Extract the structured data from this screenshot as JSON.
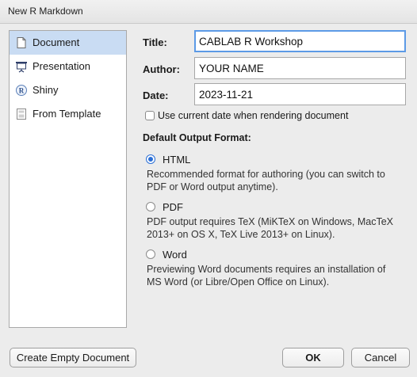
{
  "window": {
    "title": "New R Markdown"
  },
  "sidebar": {
    "items": [
      {
        "label": "Document",
        "icon": "document-icon",
        "selected": true
      },
      {
        "label": "Presentation",
        "icon": "presentation-icon",
        "selected": false
      },
      {
        "label": "Shiny",
        "icon": "shiny-icon",
        "selected": false
      },
      {
        "label": "From Template",
        "icon": "template-icon",
        "selected": false
      }
    ]
  },
  "form": {
    "title_label": "Title:",
    "title_value": "CABLAB R Workshop",
    "author_label": "Author:",
    "author_value": "YOUR NAME",
    "date_label": "Date:",
    "date_value": "2023-11-21",
    "use_current_date_label": "Use current date when rendering document",
    "use_current_date_checked": false
  },
  "output": {
    "heading": "Default Output Format:",
    "options": [
      {
        "label": "HTML",
        "selected": true,
        "desc1": "Recommended format for authoring (you can switch to",
        "desc2": "PDF or Word output anytime)."
      },
      {
        "label": "PDF",
        "selected": false,
        "desc1": "PDF output requires TeX (MiKTeX on Windows, MacTeX",
        "desc2": "2013+ on OS X, TeX Live 2013+ on Linux)."
      },
      {
        "label": "Word",
        "selected": false,
        "desc1": "Previewing Word documents requires an installation of",
        "desc2": "MS Word (or Libre/Open Office on Linux)."
      }
    ]
  },
  "buttons": {
    "create_empty": "Create Empty Document",
    "ok": "OK",
    "cancel": "Cancel"
  },
  "colors": {
    "selection": "#c9dcf3",
    "focus": "#5c9ae6",
    "radio": "#2b6fd6"
  }
}
